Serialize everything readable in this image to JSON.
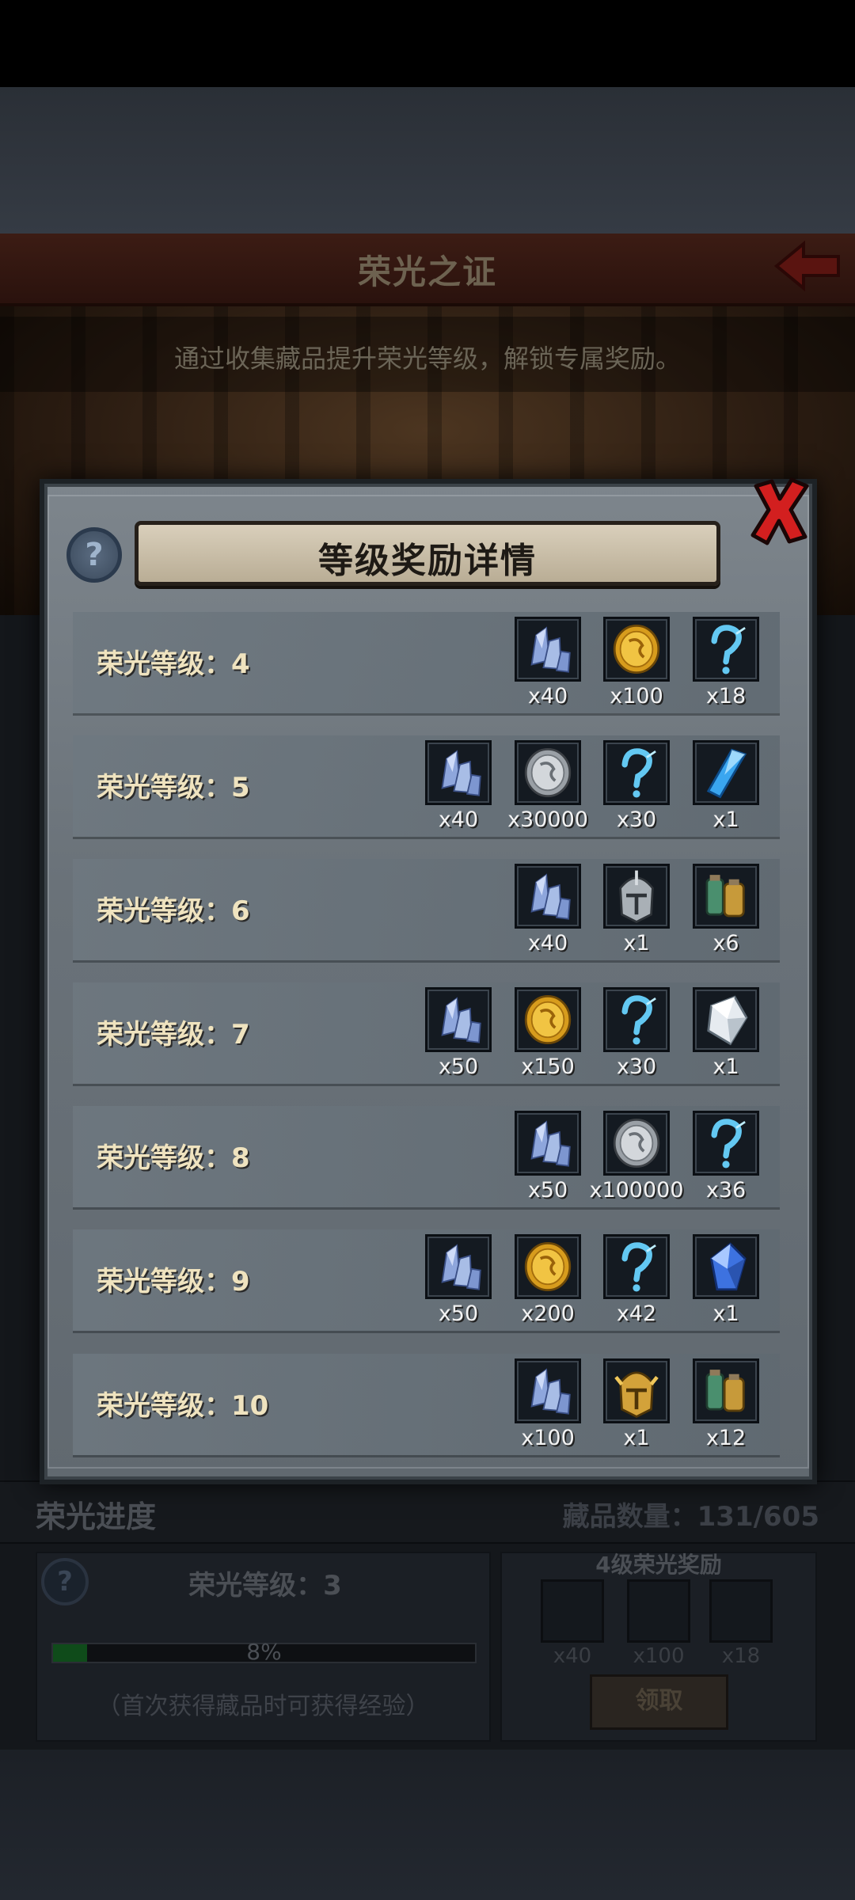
{
  "base": {
    "title": "荣光之证",
    "subtitle": "通过收集藏品提升荣光等级，解锁专属奖励。",
    "progress_title": "荣光进度",
    "collection_count": "藏品数量：131/605",
    "current_level": "荣光等级：3",
    "progress_percent": 8,
    "progress_text": "8%",
    "hint": "（首次获得藏品时可获得经验）",
    "next_reward_title": "4级荣光奖励",
    "next_rewards": [
      "x40",
      "x100",
      "x18"
    ],
    "claim_label": "领取"
  },
  "modal": {
    "title": "等级奖励详情",
    "help_label": "?",
    "rows": [
      {
        "label": "荣光等级：4",
        "items": [
          {
            "icon": "crystal-cluster-icon",
            "qty": "x40"
          },
          {
            "icon": "gold-coin-icon",
            "qty": "x100"
          },
          {
            "icon": "mystery-question-icon",
            "qty": "x18"
          }
        ]
      },
      {
        "label": "荣光等级：5",
        "items": [
          {
            "icon": "crystal-cluster-icon",
            "qty": "x40"
          },
          {
            "icon": "silver-coin-icon",
            "qty": "x30000"
          },
          {
            "icon": "mystery-question-icon",
            "qty": "x30"
          },
          {
            "icon": "blue-shard-icon",
            "qty": "x1"
          }
        ]
      },
      {
        "label": "荣光等级：6",
        "items": [
          {
            "icon": "crystal-cluster-icon",
            "qty": "x40"
          },
          {
            "icon": "silver-helmet-icon",
            "qty": "x1"
          },
          {
            "icon": "potion-bundle-icon",
            "qty": "x6"
          }
        ]
      },
      {
        "label": "荣光等级：7",
        "items": [
          {
            "icon": "crystal-cluster-icon",
            "qty": "x50"
          },
          {
            "icon": "gold-coin-icon",
            "qty": "x150"
          },
          {
            "icon": "mystery-question-icon",
            "qty": "x30"
          },
          {
            "icon": "white-diamond-icon",
            "qty": "x1"
          }
        ]
      },
      {
        "label": "荣光等级：8",
        "items": [
          {
            "icon": "crystal-cluster-icon",
            "qty": "x50"
          },
          {
            "icon": "silver-coin-icon",
            "qty": "x100000"
          },
          {
            "icon": "mystery-question-icon",
            "qty": "x36"
          }
        ]
      },
      {
        "label": "荣光等级：9",
        "items": [
          {
            "icon": "crystal-cluster-icon",
            "qty": "x50"
          },
          {
            "icon": "gold-coin-icon",
            "qty": "x200"
          },
          {
            "icon": "mystery-question-icon",
            "qty": "x42"
          },
          {
            "icon": "blue-gem-icon",
            "qty": "x1"
          }
        ]
      },
      {
        "label": "荣光等级：10",
        "items": [
          {
            "icon": "crystal-cluster-icon",
            "qty": "x100"
          },
          {
            "icon": "gold-helmet-icon",
            "qty": "x1"
          },
          {
            "icon": "potion-bundle-icon",
            "qty": "x12"
          }
        ]
      }
    ]
  },
  "colors": {
    "label_text": "#efe3bf",
    "close_red": "#d31f1f",
    "progress_green": "#0f4b1a"
  }
}
